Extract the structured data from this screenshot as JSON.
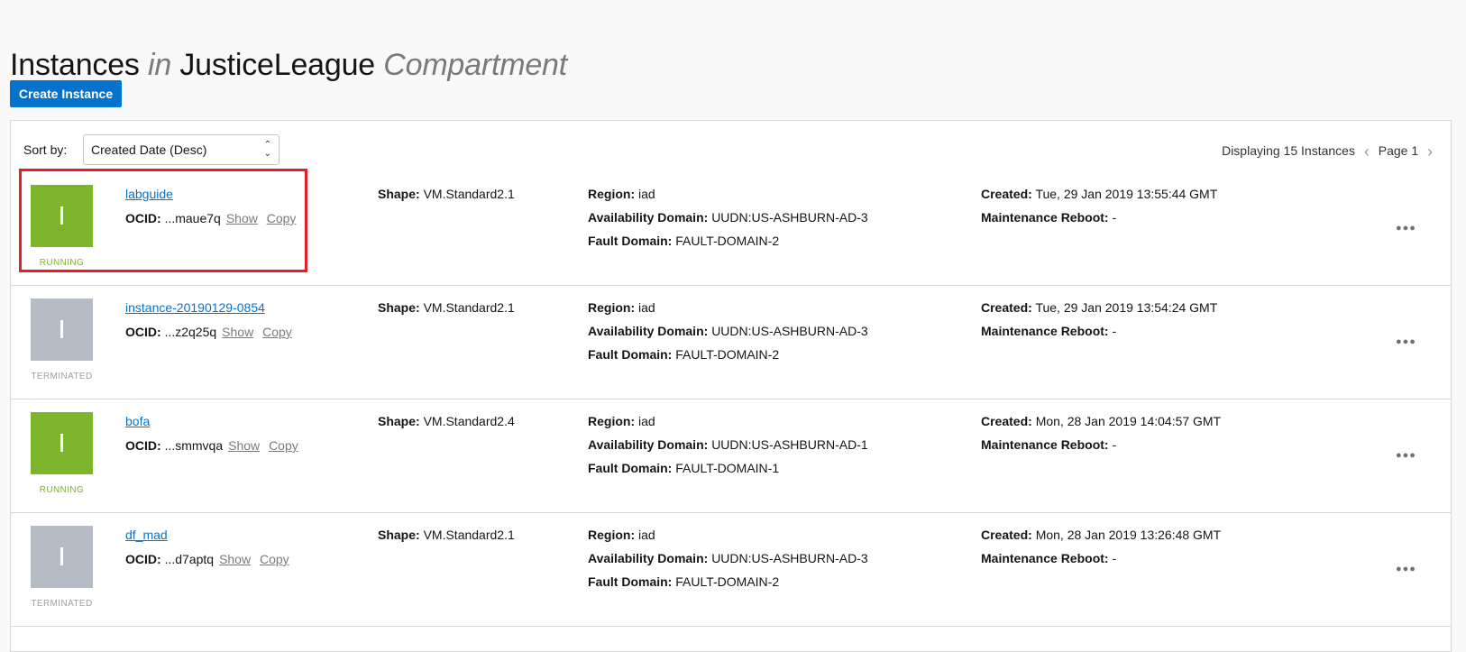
{
  "page": {
    "title_main": "Instances",
    "title_in": "in",
    "title_compartment": "JusticeLeague",
    "title_suffix": "Compartment"
  },
  "toolbar": {
    "create_label": "Create Instance",
    "sort_label": "Sort by:",
    "sort_value": "Created Date (Desc)",
    "displaying": "Displaying 15 Instances",
    "page_label": "Page 1"
  },
  "labels": {
    "ocid": "OCID:",
    "show": "Show",
    "copy": "Copy",
    "shape": "Shape:",
    "region": "Region:",
    "availability_domain": "Availability Domain:",
    "fault_domain": "Fault Domain:",
    "created": "Created:",
    "maintenance_reboot": "Maintenance Reboot:"
  },
  "colors": {
    "running": "#7cb52b",
    "terminated": "#b5bcc6",
    "link": "#0572ce",
    "highlight": "#ea1c24"
  },
  "icons": {
    "sort_chevron": "up-down-chevron-icon",
    "prev_page": "chevron-left-icon",
    "next_page": "chevron-right-icon",
    "actions": "more-horizontal-icon",
    "instance_tile": "instance-state-icon"
  },
  "instances": [
    {
      "name": "labguide",
      "state": "RUNNING",
      "ocid": "...maue7q",
      "shape": "VM.Standard2.1",
      "region": "iad",
      "availability_domain": "UUDN:US-ASHBURN-AD-3",
      "fault_domain": "FAULT-DOMAIN-2",
      "created": "Tue, 29 Jan 2019 13:55:44 GMT",
      "maintenance_reboot": "-"
    },
    {
      "name": "instance-20190129-0854",
      "state": "TERMINATED",
      "ocid": "...z2q25q",
      "shape": "VM.Standard2.1",
      "region": "iad",
      "availability_domain": "UUDN:US-ASHBURN-AD-3",
      "fault_domain": "FAULT-DOMAIN-2",
      "created": "Tue, 29 Jan 2019 13:54:24 GMT",
      "maintenance_reboot": "-"
    },
    {
      "name": "bofa",
      "state": "RUNNING",
      "ocid": "...smmvqa",
      "shape": "VM.Standard2.4",
      "region": "iad",
      "availability_domain": "UUDN:US-ASHBURN-AD-1",
      "fault_domain": "FAULT-DOMAIN-1",
      "created": "Mon, 28 Jan 2019 14:04:57 GMT",
      "maintenance_reboot": "-"
    },
    {
      "name": "df_mad",
      "state": "TERMINATED",
      "ocid": "...d7aptq",
      "shape": "VM.Standard2.1",
      "region": "iad",
      "availability_domain": "UUDN:US-ASHBURN-AD-3",
      "fault_domain": "FAULT-DOMAIN-2",
      "created": "Mon, 28 Jan 2019 13:26:48 GMT",
      "maintenance_reboot": "-"
    }
  ]
}
